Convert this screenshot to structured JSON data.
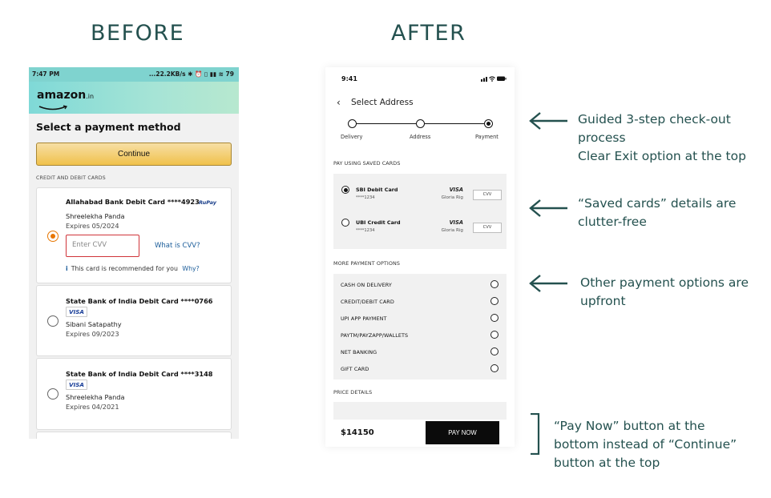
{
  "headings": {
    "before": "BEFORE",
    "after": "AFTER"
  },
  "before": {
    "status": {
      "time": "7:47 PM",
      "right": "...22.2KB/s ✱ ⏰ ▯ ▮▮ ≋ 79"
    },
    "logo": "amazon",
    "logo_suffix": ".in",
    "title": "Select a payment method",
    "continue_label": "Continue",
    "section_label": "CREDIT AND DEBIT CARDS",
    "cards": [
      {
        "bank": "Allahabad Bank Debit Card ****4923",
        "network": "RuPay",
        "holder": "Shreelekha Panda",
        "expires": "Expires 05/2024"
      },
      {
        "bank": "State Bank of India Debit Card ****0766",
        "network": "VISA",
        "holder": "Sibani Satapathy",
        "expires": "Expires 09/2023"
      },
      {
        "bank": "State Bank of India Debit Card ****3148",
        "network": "VISA",
        "holder": "Shreelekha Panda",
        "expires": "Expires 04/2021"
      }
    ],
    "cvv_placeholder": "Enter CVV",
    "what_is_cvv": "What is CVV?",
    "recommend_icon": "i",
    "recommend_text": "This card is recommended for you",
    "why_link": "Why?"
  },
  "after": {
    "time": "9:41",
    "back_icon": "‹",
    "nav_title": "Select Address",
    "steps": [
      "Delivery",
      "Address",
      "Payment"
    ],
    "saved_section": "PAY USING SAVED CARDS",
    "saved_cards": [
      {
        "name": "SBI Debit Card",
        "number": "****1234",
        "network": "VISA",
        "holder": "Gloria Rig",
        "cvv": "CVV"
      },
      {
        "name": "UBI Credit Card",
        "number": "****1234",
        "network": "VISA",
        "holder": "Gloria Rig",
        "cvv": "CVV"
      }
    ],
    "more_section": "MORE PAYMENT OPTIONS",
    "options": [
      "CASH ON DELIVERY",
      "CREDIT/DEBIT CARD",
      "UPI APP PAYMENT",
      "PAYTM/PAYZAPP/WALLETS",
      "NET BANKING",
      "GIFT CARD"
    ],
    "price_section": "PRICE DETAILS",
    "total": "$14150",
    "pay_now": "PAY NOW"
  },
  "annotations": {
    "steps_note": [
      "Guided 3-step check-out",
      "process",
      "Clear Exit option at the top"
    ],
    "saved_note": [
      "“Saved cards” details are",
      "clutter-free"
    ],
    "options_note": [
      "Other payment options are",
      "upfront"
    ],
    "paynow_note": [
      "“Pay Now” button at the",
      "bottom instead of “Continue”",
      "button at the top"
    ]
  },
  "colors": {
    "accent": "#24514f",
    "amazon_header": "#7fd3cf",
    "continue_button": "#f0c14b",
    "pay_now_button": "#0b0b0b"
  }
}
